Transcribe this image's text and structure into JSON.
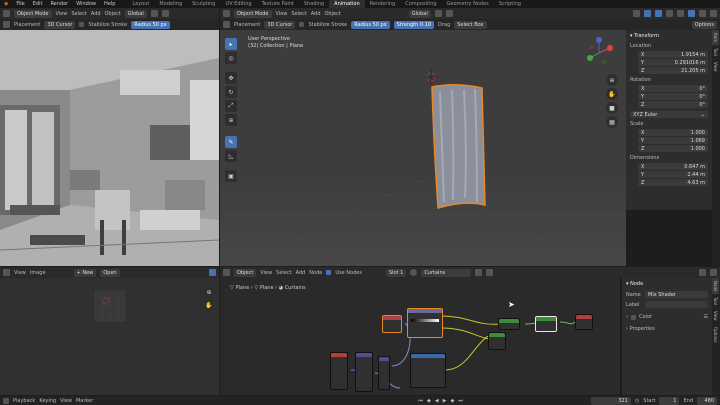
{
  "topbar": {
    "menus": [
      "File",
      "Edit",
      "Render",
      "Window",
      "Help"
    ],
    "workspaces": [
      "Layout",
      "Modeling",
      "Sculpting",
      "UV Editing",
      "Texture Paint",
      "Shading",
      "Animation",
      "Rendering",
      "Compositing",
      "Geometry Nodes",
      "Scripting"
    ],
    "active_workspace": "Animation"
  },
  "left_viewport": {
    "mode": "Object Mode",
    "menus": [
      "View",
      "Select",
      "Add",
      "Object"
    ],
    "orientation": "Global",
    "placement_label": "Placement",
    "placement_value": "3D Cursor",
    "stabilize": "Stabilize Stroke",
    "radius_label": "Radius",
    "radius_value": "50 px"
  },
  "main_viewport": {
    "mode": "Object Mode",
    "menus": [
      "View",
      "Select",
      "Add",
      "Object"
    ],
    "orientation": "Global",
    "placement_label": "Placement",
    "placement_value": "3D Cursor",
    "stabilize": "Stabilize Stroke",
    "radius_label": "Radius",
    "radius_value": "50 px",
    "strength_label": "Strength",
    "strength_value": "0.10",
    "drag_label": "Drag",
    "drag_value": "Select Box",
    "options_label": "Options",
    "overlay_line1": "User Perspective",
    "overlay_line2": "(32) Collection | Plane",
    "tools": [
      "select",
      "cursor",
      "move",
      "rotate",
      "scale",
      "transform",
      "annotate",
      "measure",
      "add-cube"
    ]
  },
  "transform_panel": {
    "title": "Transform",
    "location_label": "Location",
    "location": [
      {
        "axis": "X",
        "value": "1.9154 m"
      },
      {
        "axis": "Y",
        "value": "0.291016 m"
      },
      {
        "axis": "Z",
        "value": "21.205 m"
      }
    ],
    "rotation_label": "Rotation",
    "rotation": [
      {
        "axis": "X",
        "value": "0°"
      },
      {
        "axis": "Y",
        "value": "0°"
      },
      {
        "axis": "Z",
        "value": "0°"
      }
    ],
    "rotation_mode": "XYZ Euler",
    "scale_label": "Scale",
    "scale": [
      {
        "axis": "X",
        "value": "1.000"
      },
      {
        "axis": "Y",
        "value": "1.069"
      },
      {
        "axis": "Z",
        "value": "1.000"
      }
    ],
    "dimensions_label": "Dimensions",
    "dimensions": [
      {
        "axis": "X",
        "value": "0.647 m"
      },
      {
        "axis": "Y",
        "value": "2.44 m"
      },
      {
        "axis": "Z",
        "value": "4.63 m"
      }
    ],
    "side_tabs": [
      "Item",
      "Tool",
      "View"
    ]
  },
  "image_editor": {
    "menus": [
      "View",
      "Image"
    ],
    "new_label": "New",
    "open_label": "Open"
  },
  "node_editor": {
    "object_label": "Object",
    "menus": [
      "View",
      "Select",
      "Add",
      "Node"
    ],
    "use_nodes": "Use Nodes",
    "slot": "Slot 1",
    "material": "Curtains",
    "breadcrumb": [
      "Plane",
      "Plane",
      "Curtains"
    ]
  },
  "node_panel": {
    "title": "Node",
    "name_label": "Name",
    "name_value": "Mix Shader",
    "label_label": "Label",
    "color_label": "Color",
    "properties_label": "Properties",
    "side_tabs": [
      "Node",
      "Tool",
      "View",
      "Options"
    ]
  },
  "timeline": {
    "menus": [
      "Playback",
      "Keying",
      "View",
      "Marker"
    ],
    "current_frame": "321",
    "start_label": "Start",
    "start_value": "1",
    "end_label": "End",
    "end_value": "480"
  },
  "colors": {
    "accent": "#4772b3",
    "selection_outline": "#e8882a",
    "viewport_bg": "#3d3d3d",
    "node_shader_header": "#3c8c3c",
    "node_texture_header": "#b04040",
    "node_vector_header": "#5a4a8c"
  }
}
